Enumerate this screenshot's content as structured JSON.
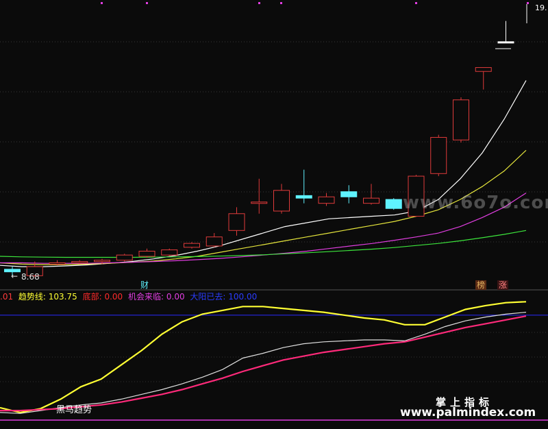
{
  "chart_data": [
    {
      "type": "candlestick",
      "price_markers": {
        "high": "19.",
        "low": "8.68",
        "low_arrow": "←"
      },
      "tags": {
        "cai": "财",
        "bang": "榜",
        "zhang": "涨"
      },
      "candles": [
        {
          "o": 8.8,
          "h": 8.9,
          "l": 8.55,
          "c": 8.7,
          "color": "#5ff3ff"
        },
        {
          "o": 8.55,
          "h": 9.1,
          "l": 8.5,
          "c": 8.9,
          "color": "#e03b3b"
        },
        {
          "o": 9.05,
          "h": 9.15,
          "l": 8.95,
          "c": 9.05,
          "color": "#e03b3b"
        },
        {
          "o": 9.05,
          "h": 9.15,
          "l": 9.0,
          "c": 9.1,
          "color": "#e03b3b"
        },
        {
          "o": 9.1,
          "h": 9.2,
          "l": 9.0,
          "c": 9.15,
          "color": "#e03b3b"
        },
        {
          "o": 9.15,
          "h": 9.4,
          "l": 9.1,
          "c": 9.35,
          "color": "#e03b3b"
        },
        {
          "o": 9.3,
          "h": 9.6,
          "l": 9.25,
          "c": 9.5,
          "color": "#e03b3b"
        },
        {
          "o": 9.35,
          "h": 9.6,
          "l": 9.3,
          "c": 9.55,
          "color": "#e03b3b"
        },
        {
          "o": 9.65,
          "h": 9.85,
          "l": 9.6,
          "c": 9.8,
          "color": "#e03b3b"
        },
        {
          "o": 9.7,
          "h": 10.2,
          "l": 9.65,
          "c": 10.05,
          "color": "#e03b3b"
        },
        {
          "o": 10.3,
          "h": 11.2,
          "l": 10.1,
          "c": 10.95,
          "color": "#e03b3b"
        },
        {
          "o": 11.35,
          "h": 12.3,
          "l": 10.95,
          "c": 11.4,
          "color": "#e03b3b"
        },
        {
          "o": 11.05,
          "h": 12.1,
          "l": 10.95,
          "c": 11.85,
          "color": "#e03b3b"
        },
        {
          "o": 11.65,
          "h": 12.65,
          "l": 11.35,
          "c": 11.55,
          "color": "#5ff3ff"
        },
        {
          "o": 11.35,
          "h": 11.75,
          "l": 11.25,
          "c": 11.6,
          "color": "#e03b3b"
        },
        {
          "o": 11.8,
          "h": 12.05,
          "l": 11.35,
          "c": 11.6,
          "color": "#5ff3ff"
        },
        {
          "o": 11.35,
          "h": 12.1,
          "l": 11.3,
          "c": 11.55,
          "color": "#e03b3b"
        },
        {
          "o": 11.5,
          "h": 11.55,
          "l": 11.1,
          "c": 11.15,
          "color": "#5ff3ff"
        },
        {
          "o": 10.85,
          "h": 12.45,
          "l": 10.85,
          "c": 12.4,
          "color": "#e03b3b"
        },
        {
          "o": 12.5,
          "h": 14.0,
          "l": 12.4,
          "c": 13.9,
          "color": "#e03b3b"
        },
        {
          "o": 13.8,
          "h": 15.45,
          "l": 13.7,
          "c": 15.35,
          "color": "#e03b3b"
        },
        {
          "o": 16.45,
          "h": 16.6,
          "l": 15.75,
          "c": 16.6,
          "color": "#e03b3b"
        },
        {
          "o": 17.6,
          "h": 18.4,
          "l": 17.6,
          "c": 17.6,
          "color": "#ffffff"
        }
      ],
      "ma_lines": [
        {
          "name": "",
          "color": "#ffffff",
          "values": [
            8.95,
            8.9,
            8.9,
            8.93,
            8.97,
            9.03,
            9.1,
            9.2,
            9.33,
            9.5,
            9.7,
            9.95,
            10.2,
            10.45,
            10.6,
            10.75,
            10.8,
            10.85,
            10.9,
            11.05,
            11.5,
            12.3,
            13.3,
            14.6,
            16.1
          ]
        },
        {
          "name": "",
          "color": "#e6e63c",
          "values": [
            9.05,
            9.0,
            8.98,
            8.98,
            9.0,
            9.03,
            9.07,
            9.12,
            9.2,
            9.3,
            9.45,
            9.6,
            9.75,
            9.9,
            10.05,
            10.2,
            10.35,
            10.5,
            10.65,
            10.85,
            11.1,
            11.5,
            12.0,
            12.6,
            13.4
          ]
        },
        {
          "name": "",
          "color": "#e13ee1",
          "values": [
            9.05,
            9.05,
            9.03,
            9.03,
            9.03,
            9.05,
            9.07,
            9.1,
            9.13,
            9.17,
            9.22,
            9.28,
            9.35,
            9.42,
            9.5,
            9.6,
            9.7,
            9.8,
            9.92,
            10.05,
            10.2,
            10.45,
            10.8,
            11.2,
            11.75
          ]
        },
        {
          "name": "",
          "color": "#3ce63c",
          "values": [
            9.3,
            9.28,
            9.27,
            9.26,
            9.26,
            9.26,
            9.26,
            9.27,
            9.28,
            9.29,
            9.31,
            9.33,
            9.36,
            9.4,
            9.44,
            9.48,
            9.53,
            9.58,
            9.64,
            9.72,
            9.8,
            9.9,
            10.02,
            10.15,
            10.3
          ]
        }
      ]
    },
    {
      "type": "line",
      "header": {
        "prefix": ".01",
        "trend": "趋势线: 103.75",
        "bottom": "底部: 0.00",
        "chance": "机会来临: 0.00",
        "big": "大阳已去: 100.00"
      },
      "label_heima": "黑马趋势",
      "series": [
        {
          "name": "趋势线",
          "color": "#ffff33",
          "values": [
            3,
            -2,
            2,
            12,
            25,
            33,
            48,
            63,
            80,
            93,
            101,
            105,
            109,
            109,
            107,
            105,
            103,
            100,
            97,
            95,
            90,
            90,
            98,
            106,
            110,
            113,
            114
          ]
        },
        {
          "name": "",
          "color": "#e0e0e0",
          "values": [
            -2,
            -3,
            0,
            3,
            6,
            8,
            12,
            17,
            22,
            28,
            35,
            43,
            55,
            60,
            66,
            70,
            72,
            73,
            74,
            74,
            73,
            80,
            88,
            94,
            98,
            101,
            103
          ]
        },
        {
          "name": "",
          "color": "#ff2a7a",
          "values": [
            0,
            0,
            1,
            2,
            4,
            6,
            9,
            13,
            17,
            22,
            28,
            34,
            41,
            47,
            53,
            57,
            61,
            64,
            67,
            70,
            72,
            77,
            82,
            87,
            91,
            95,
            99
          ]
        }
      ],
      "ref_lines": {
        "top": 100,
        "bottom": -10
      }
    }
  ],
  "watermark": "www.6o7o.com",
  "brand": {
    "title": "掌上指标",
    "url": "www.palmindex.com"
  }
}
